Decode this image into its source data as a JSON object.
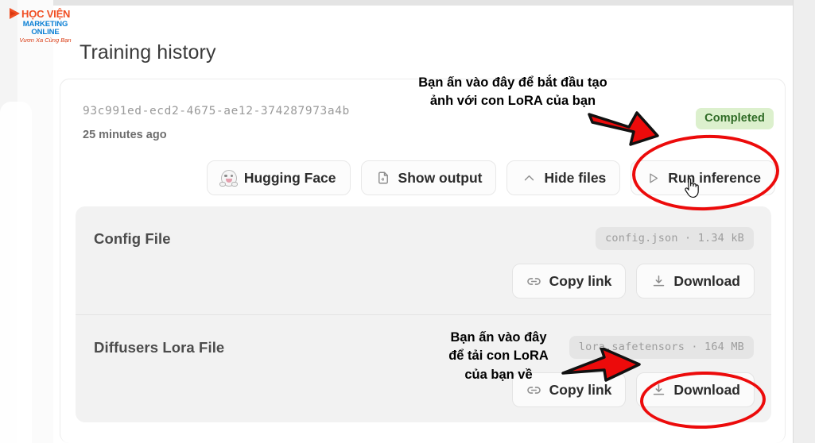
{
  "logo": {
    "name": "HỌC VIỆN",
    "subtitle": "MARKETING ONLINE",
    "tagline": "Vươn Xa Cùng Bạn",
    "mark_color": "#f04e23",
    "sub_color": "#0a7fd4"
  },
  "page": {
    "title": "Training history"
  },
  "run": {
    "id": "93c991ed-ecd2-4675-ae12-374287973a4b",
    "time": "25 minutes ago",
    "status": "Completed",
    "status_bg": "#dcf0cd",
    "status_fg": "#2f6b26",
    "actions": [
      {
        "label": "Hugging Face",
        "icon": "hugging-face-icon"
      },
      {
        "label": "Show output",
        "icon": "file-output-icon"
      },
      {
        "label": "Hide files",
        "icon": "chevron-up-icon"
      },
      {
        "label": "Run inference",
        "icon": "play-triangle-icon"
      }
    ]
  },
  "files": [
    {
      "label": "Config File",
      "chip": "config.json · 1.34 kB",
      "copy_label": "Copy link",
      "copy_icon": "link-icon",
      "download_label": "Download",
      "download_icon": "download-icon"
    },
    {
      "label": "Diffusers Lora File",
      "chip": "lora.safetensors · 164 MB",
      "copy_label": "Copy link",
      "copy_icon": "link-icon",
      "download_label": "Download",
      "download_icon": "download-icon"
    }
  ],
  "annotations": {
    "accent_color": "#ec0b0b",
    "note_run_inference": "Bạn ấn vào đây để bắt đầu tạo\nảnh với con LoRA của bạn",
    "note_download": "Bạn ấn vào đây\nđể tải con LoRA\ncủa bạn về"
  }
}
